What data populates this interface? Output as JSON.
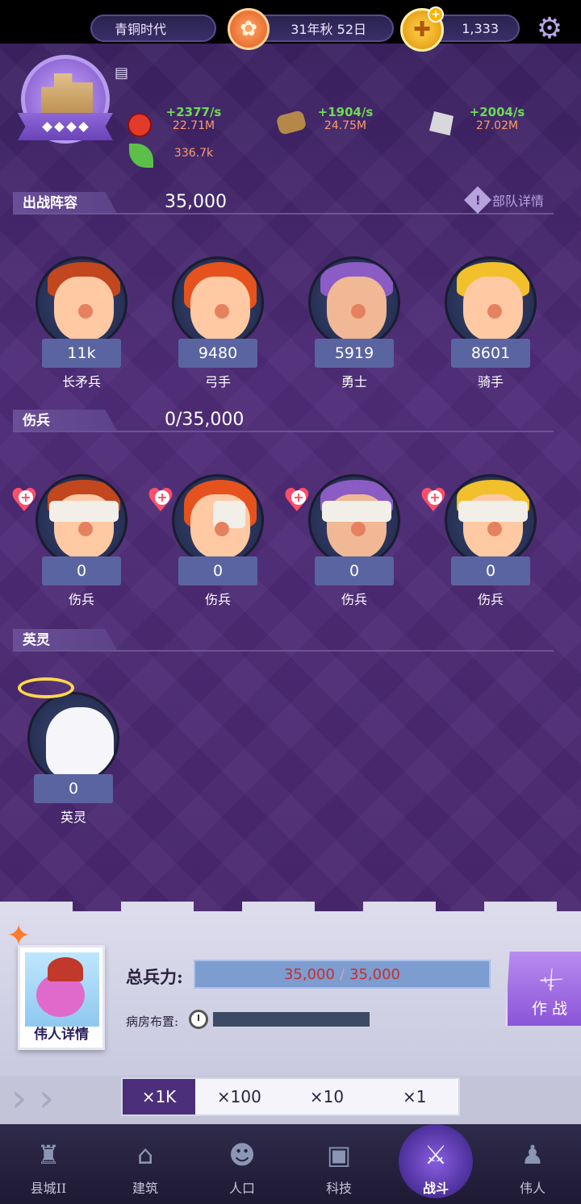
{
  "header": {
    "era": "青铜时代",
    "date": "31年秋 52日",
    "coins": "1,333",
    "icons": [
      "castle-icon",
      "season-leaf-icon",
      "coin-icon",
      "gear-icon"
    ]
  },
  "resources": [
    {
      "icon": "food-apple-icon",
      "rate": "+2377/s",
      "total": "22.71M"
    },
    {
      "icon": "wood-log-icon",
      "rate": "+1904/s",
      "total": "24.75M"
    },
    {
      "icon": "stone-icon",
      "rate": "+2004/s",
      "total": "27.02M"
    },
    {
      "icon": "herb-leaf-icon",
      "rate": "",
      "total": "336.7k"
    }
  ],
  "lineup": {
    "title": "出战阵容",
    "value": "35,000",
    "detail_link": "部队详情",
    "units": [
      {
        "count": "11k",
        "name": "长矛兵"
      },
      {
        "count": "9480",
        "name": "弓手"
      },
      {
        "count": "5919",
        "name": "勇士"
      },
      {
        "count": "8601",
        "name": "骑手"
      }
    ]
  },
  "wounded": {
    "title": "伤兵",
    "value": "0/35,000",
    "units": [
      {
        "count": "0",
        "name": "伤兵"
      },
      {
        "count": "0",
        "name": "伤兵"
      },
      {
        "count": "0",
        "name": "伤兵"
      },
      {
        "count": "0",
        "name": "伤兵"
      }
    ]
  },
  "heroes": {
    "title": "英灵",
    "units": [
      {
        "count": "0",
        "name": "英灵"
      }
    ]
  },
  "bottom": {
    "hero_detail": "伟人详情",
    "total_label": "总兵力:",
    "total_current": "35,000",
    "total_max": "35,000",
    "ward_label": "病房布置:",
    "fight_label": "作战"
  },
  "multipliers": {
    "options": [
      "×1K",
      "×100",
      "×10",
      "×1"
    ],
    "selected": "×1K"
  },
  "nav": {
    "items": [
      {
        "label": "县城II",
        "icon": "town-icon"
      },
      {
        "label": "建筑",
        "icon": "building-icon"
      },
      {
        "label": "人口",
        "icon": "population-icon"
      },
      {
        "label": "科技",
        "icon": "tech-book-icon"
      },
      {
        "label": "战斗",
        "icon": "battle-swords-icon"
      },
      {
        "label": "伟人",
        "icon": "great-person-icon"
      }
    ],
    "active": "战斗"
  },
  "colors": {
    "background": "#4a2870",
    "rate_green": "#6ddb55",
    "total_orange": "#ff9b6b",
    "count_box": "#5a64a0",
    "fight_button": "#a070e4",
    "heal_red": "#ff4d6a"
  }
}
